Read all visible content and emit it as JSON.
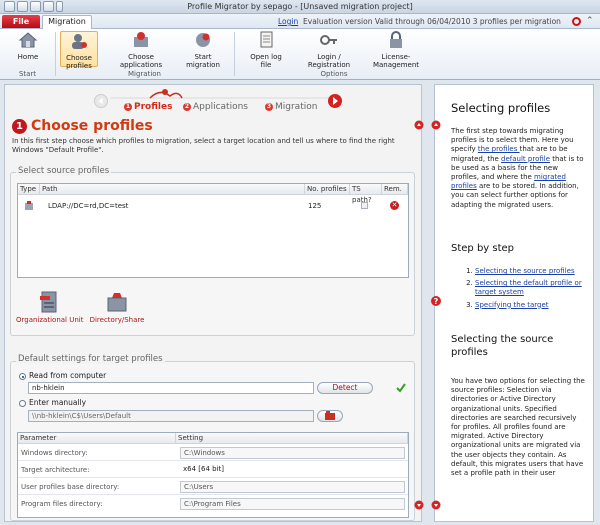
{
  "window": {
    "title": "Profile Migrator by sepago - [Unsaved migration project]"
  },
  "tabs": {
    "file": "File",
    "migration": "Migration"
  },
  "top_links": {
    "login": "Login",
    "status": "Evaluation version   Valid through 06/04/2010   3 profiles per migration"
  },
  "ribbon": {
    "home": "Home",
    "choose_profiles": [
      "Choose",
      "profiles"
    ],
    "choose_applications": [
      "Choose",
      "applications"
    ],
    "start_migration": [
      "Start",
      "migration"
    ],
    "open_log_file": [
      "Open log",
      "file"
    ],
    "login_registration": [
      "Login /",
      "Registration"
    ],
    "license_management": [
      "License-",
      "Management"
    ],
    "groups": {
      "start": "Start",
      "migration": "Migration",
      "options": "Options"
    }
  },
  "wizard": {
    "steps": [
      "Profiles",
      "Applications",
      "Migration"
    ],
    "numbers": [
      "1",
      "2",
      "3"
    ]
  },
  "page": {
    "step_number": "1",
    "title": "Choose profiles",
    "intro": "In this first step choose which profiles to migration, select a target location and tell us where to find the right Windows \"Default Profile\"."
  },
  "source_profiles": {
    "group_title": "Select source profiles",
    "columns": [
      "Type",
      "Path",
      "No. profiles",
      "TS path?",
      "Rem."
    ],
    "rows": [
      {
        "path": "LDAP://DC=rd,DC=test",
        "count": "125"
      }
    ],
    "add_buttons": {
      "ou": "Organizational Unit",
      "dir": "Directory/Share"
    }
  },
  "target": {
    "group_title": "Default settings for target profiles",
    "read_from_computer": "Read from computer",
    "computer_value": "nb-hklein",
    "detect_button": "Detect",
    "enter_manually": "Enter manually",
    "manual_value": "\\\\nb-hklein\\C$\\Users\\Default",
    "settings_columns": [
      "Parameter",
      "Setting"
    ],
    "settings": [
      {
        "name": "Windows directory:",
        "value": "C:\\Windows"
      },
      {
        "name": "Target architecture:",
        "value": "x64 [64 bit]"
      },
      {
        "name": "User profiles base directory:",
        "value": "C:\\Users"
      },
      {
        "name": "Program files directory:",
        "value": "C:\\Program Files"
      }
    ]
  },
  "help": {
    "title": "Selecting profiles",
    "p1_a": "The first step towards migrating profiles is to select them. Here you specify ",
    "p1_link1": "the profiles ",
    "p1_b": "that are to be migrated, the ",
    "p1_link2": "default profile",
    "p1_c": " that is to be used as a basis for the new profiles, and where the ",
    "p1_link3": "migrated profiles",
    "p1_d": " are to be stored. In addition, you can select further options for adapting the migrated users.",
    "step_title": "Step by step",
    "steps": [
      "Selecting the source profiles",
      "Selecting the default profile or target system",
      "Specifying the target"
    ],
    "section_title": "Selecting the source profiles",
    "p2": "You have two options for selecting the source profiles: Selection via directories or Active Directory organizational units. Specified directories are searched recursively for profiles. All profiles found are migrated. Active Directory organizational units are migrated via the user objects they contain. As default, this migrates users that have set a profile path in their user"
  },
  "colors": {
    "accent": "#d23a10",
    "file_tab": "#c4161c",
    "link": "#1a3fa8"
  }
}
